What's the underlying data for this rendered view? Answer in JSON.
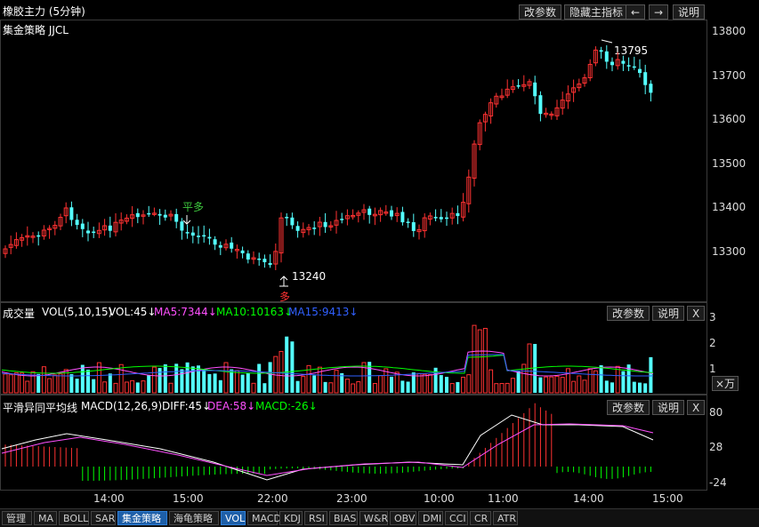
{
  "header": {
    "title": "橡胶主力 (5分钟)",
    "buttons": [
      "改参数",
      "隐藏主指标",
      "←",
      "→",
      "说明"
    ]
  },
  "main_panel": {
    "strategy_label": "集金策略 JJCL",
    "y_ticks": [
      "13800",
      "13700",
      "13600",
      "13500",
      "13400",
      "13300"
    ],
    "high_label": "13795",
    "low_label": "13240",
    "signal_flat_long": "平多",
    "signal_long": "多"
  },
  "volume_panel": {
    "name": "成交量",
    "params": "VOL(5,10,15)",
    "vol": "VOL:45↓",
    "ma5": "MA5:7344↓",
    "ma10": "MA10:10163↓",
    "ma15": "MA15:9413↓",
    "buttons": [
      "改参数",
      "说明",
      "X"
    ],
    "y_ticks": [
      "3",
      "2",
      "1"
    ],
    "unit_button": "×万"
  },
  "macd_panel": {
    "name": "平滑异同平均线",
    "params": "MACD(12,26,9)",
    "diff": "DIFF:45↓",
    "dea": "DEA:58↓",
    "macd": "MACD:-26↓",
    "buttons": [
      "改参数",
      "说明",
      "X"
    ],
    "y_ticks": [
      "80",
      "28",
      "-24"
    ]
  },
  "x_ticks": [
    "14:00",
    "15:00",
    "22:00",
    "23:00",
    "10:00",
    "11:00",
    "14:00",
    "15:00"
  ],
  "tabs": [
    "管理",
    "MA",
    "BOLL",
    "SAR",
    "集金策略",
    "海龟策略",
    "VOL",
    "MACD",
    "KDJ",
    "RSI",
    "BIAS",
    "W&R",
    "OBV",
    "DMI",
    "CCI",
    "CR",
    "ATR"
  ],
  "colors": {
    "up": "#ff3232",
    "down": "#54ffff",
    "ma5": "#ff50ff",
    "ma10": "#00ff00",
    "ma15": "#3060ff",
    "dif": "#ffffff",
    "dea": "#ff50ff",
    "signal": "#3ec93e"
  }
}
